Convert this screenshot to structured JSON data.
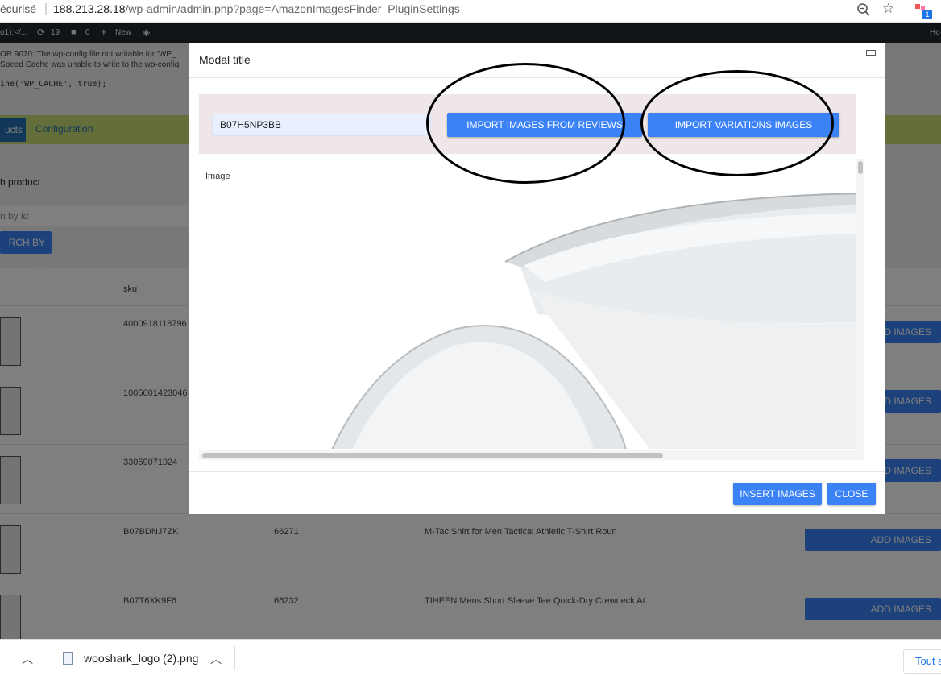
{
  "browser": {
    "secure_label": "écurisé",
    "separator": "|",
    "url_host": "188.213.28.18",
    "url_path": "/wp-admin/admin.php?page=AmazonImagesFinder_PluginSettings",
    "extension_badge": "1"
  },
  "adminbar": {
    "site_fragment": "o1);</...",
    "updates_count": "19",
    "comments_count": "0",
    "new_label": "New",
    "right_label": "Ho"
  },
  "page": {
    "error_line1": "OR 9070: The wp-config file not writable for 'WP_",
    "error_line2": "Speed Cache was unable to write to the wp-config",
    "code_line": "ine('WP_CACHE', true);",
    "tab_products": "ucts",
    "tab_configuration": "Configuration",
    "section_title": "h product",
    "search_placeholder": "n by id",
    "search_button": "RCH BY ID",
    "table_header_sku": "sku",
    "rows": [
      {
        "sku": "4000918118796",
        "id": "",
        "title": "",
        "button": "DD IMAGES"
      },
      {
        "sku": "1005001423046",
        "id": "",
        "title": "",
        "button": "DD IMAGES"
      },
      {
        "sku": "33059071924",
        "id": "",
        "title": "",
        "button": "DD IMAGES"
      },
      {
        "sku": "B07BDNJ7ZK",
        "id": "66271",
        "title": "M-Tac Shirt for Men Tactical Athletic T-Shirt Roun",
        "button": "ADD IMAGES"
      },
      {
        "sku": "B07T6XK9F6",
        "id": "66232",
        "title": "TIHEEN Mens Short Sleeve Tee Quick-Dry Crewneck At",
        "button": "ADD IMAGES"
      }
    ]
  },
  "modal": {
    "title": "Modal title",
    "asin_value": "B07H5NP3BB",
    "import_reviews_label": "IMPORT IMAGES FROM REVIEWS",
    "import_variations_label": "IMPORT VARIATIONS IMAGES",
    "column_image": "Image",
    "insert_label": "INSERT IMAGES",
    "close_label": "CLOSE"
  },
  "downloads": {
    "filename": "wooshark_logo (2).png",
    "show_all": "Tout a"
  },
  "colors": {
    "primary": "#3b82f6",
    "tabs_band": "#c9dd74",
    "adminbar": "#23282d",
    "toolbar_bg": "#efe7e7"
  },
  "icons": [
    "search-zoom-icon",
    "star-icon",
    "extension-icon",
    "updates-icon",
    "comment-icon",
    "plus-icon",
    "diamond-icon",
    "minimize-icon",
    "chevron-up-icon",
    "file-icon"
  ]
}
